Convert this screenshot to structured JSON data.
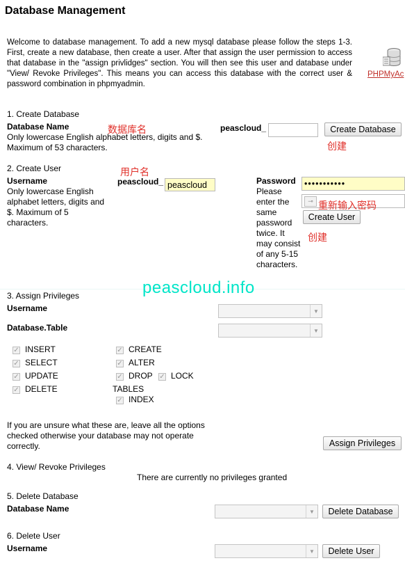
{
  "page_title": "Database Management",
  "intro_text": "Welcome to database management. To add a new mysql database please follow the steps 1-3. First, create a new database, then create a user. After that assign the user permission to access that database in the \"assign privlidges\" section. You will then see this user and database under \"View/ Revoke Privileges\". This means you can access this database with the correct user & password combination in phpmyadmin.",
  "phpmyadmin_link": "PHPMyAc",
  "create_db": {
    "heading": "1. Create Database",
    "name_label": "Database Name",
    "hint": "Only lowercase English alphabet letters, digits and $. Maximum of 53 characters.",
    "prefix": "peascloud_",
    "value": "",
    "button": "Create Database",
    "annot_name": "数据库名",
    "annot_button": "创建"
  },
  "create_user": {
    "heading": "2. Create User",
    "username_label": "Username",
    "hint": "Only lowercase English alphabet letters, digits and $. Maximum of 5 characters.",
    "prefix": "peascloud_",
    "username_value": "peascloud",
    "password_label": "Password",
    "password_hint": "Please enter the same password twice. It may consist of any 5-15 characters.",
    "password_value": "•••••••••••",
    "confirm_value": "",
    "button": "Create User",
    "annot_username": "用户名",
    "annot_confirm": "重新输入密码",
    "annot_button": "创建"
  },
  "watermark": "peascloud.info",
  "assign": {
    "heading": "3. Assign Privileges",
    "username_label": "Username",
    "table_label": "Database.Table",
    "privileges": {
      "insert": "INSERT",
      "select": "SELECT",
      "update": "UPDATE",
      "delete": "DELETE",
      "create": "CREATE",
      "alter": "ALTER",
      "drop": "DROP",
      "lock": "LOCK",
      "tables": "TABLES",
      "index": "INDEX"
    },
    "note": "If you are unsure what these are, leave all the options checked otherwise your database may not operate correctly.",
    "button": "Assign Privileges"
  },
  "view": {
    "heading": "4. View/ Revoke Privileges",
    "empty_text": "There are currently no privileges granted"
  },
  "delete_db": {
    "heading": "5. Delete Database",
    "name_label": "Database Name",
    "button": "Delete Database"
  },
  "delete_user": {
    "heading": "6. Delete User",
    "username_label": "Username",
    "button": "Delete User"
  },
  "colors": {
    "annotation_red": "#e0302a",
    "watermark": "#00e5c8",
    "input_yellow": "#fffdc6"
  }
}
